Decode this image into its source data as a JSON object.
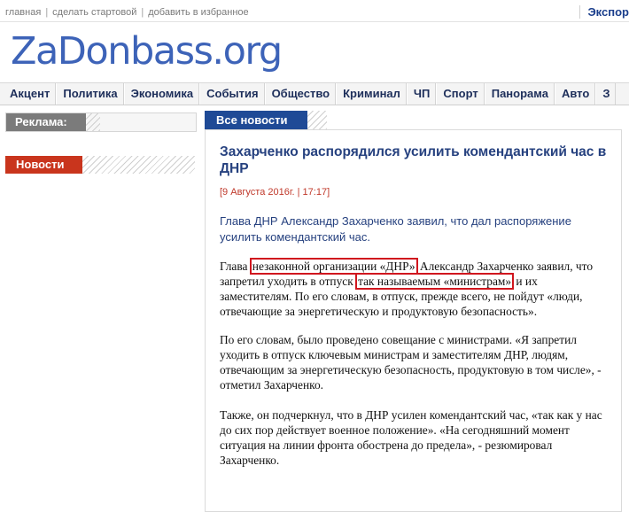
{
  "toplinks": {
    "home": "главная",
    "make_start": "сделать стартовой",
    "add_favorites": "добавить в избранное",
    "export": "Экспор"
  },
  "logo": "ZaDonbass.org",
  "nav": [
    "Акцент",
    "Политика",
    "Экономика",
    "События",
    "Общество",
    "Криминал",
    "ЧП",
    "Спорт",
    "Панорама",
    "Авто",
    "З"
  ],
  "sidebar": {
    "ads_label": "Реклама:",
    "news_label": "Новости",
    "blurred_items": [
      {
        "meta": "",
        "date": "",
        "text": ""
      },
      {
        "meta": "",
        "date": "",
        "text": ""
      },
      {
        "meta": "",
        "date": "",
        "text": ""
      },
      {
        "meta": "",
        "date": "",
        "text": ""
      },
      {
        "meta": "",
        "date": "",
        "text": ""
      }
    ]
  },
  "main": {
    "section_label": "Все новости",
    "title": "Захарченко распорядился усилить комендантский час в ДНР",
    "datetime": "[9 Августа 2016г. | 17:17]",
    "lead": "Глава ДНР Александр Захарченко заявил, что дал распоряжение усилить комендантский час.",
    "p1_a": "Глава ",
    "p1_hl1": "незаконной организации «ДНР»",
    "p1_b": " Александр Захарченко заявил, что запретил уходить в отпуск ",
    "p1_hl2": "так называемым «министрам»",
    "p1_c": " и их заместителям. По его словам, в отпуск, прежде всего, не пойдут «люди, отвечающие за энергетическую и продуктовую безопасность».",
    "p2": "По его словам, было проведено совещание с министрами. «Я запретил уходить в отпуск ключевым министрам и заместителям ДНР, людям, отвечающим за энергетическую безопасность, продуктовую в том числе», - отметил Захарченко.",
    "p3": "Также, он подчеркнул, что в ДНР усилен комендантский час, «так как у нас до сих пор действует военное положение». «На сегодняшний момент ситуация на линии фронта обострена до предела», - резюмировал Захарченко."
  },
  "colors": {
    "logo_blue": "#3d63b8",
    "nav_text": "#1d2e5a",
    "section_blue": "#1f4a96",
    "news_red": "#c9351d",
    "highlight_red": "#d0161e"
  }
}
